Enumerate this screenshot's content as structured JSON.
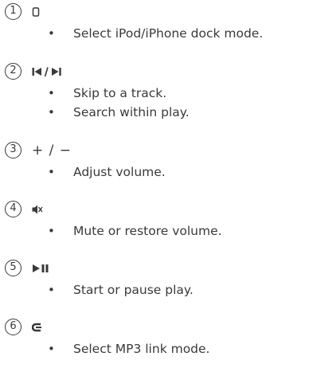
{
  "items": [
    {
      "number": "1",
      "bullets": [
        "Select iPod/iPhone dock mode."
      ]
    },
    {
      "number": "2",
      "bullets": [
        "Skip to a track.",
        "Search within play."
      ]
    },
    {
      "number": "3",
      "symbol_text": "+ / −",
      "bullets": [
        "Adjust volume."
      ]
    },
    {
      "number": "4",
      "bullets": [
        "Mute or restore volume."
      ]
    },
    {
      "number": "5",
      "bullets": [
        "Start or pause play."
      ]
    },
    {
      "number": "6",
      "bullets": [
        "Select MP3 link mode."
      ]
    }
  ],
  "icons": [
    "dock-icon",
    "skip-icon",
    "volume-icon",
    "mute-icon",
    "play-pause-icon",
    "mp3-link-icon"
  ],
  "bullet_char": "•"
}
